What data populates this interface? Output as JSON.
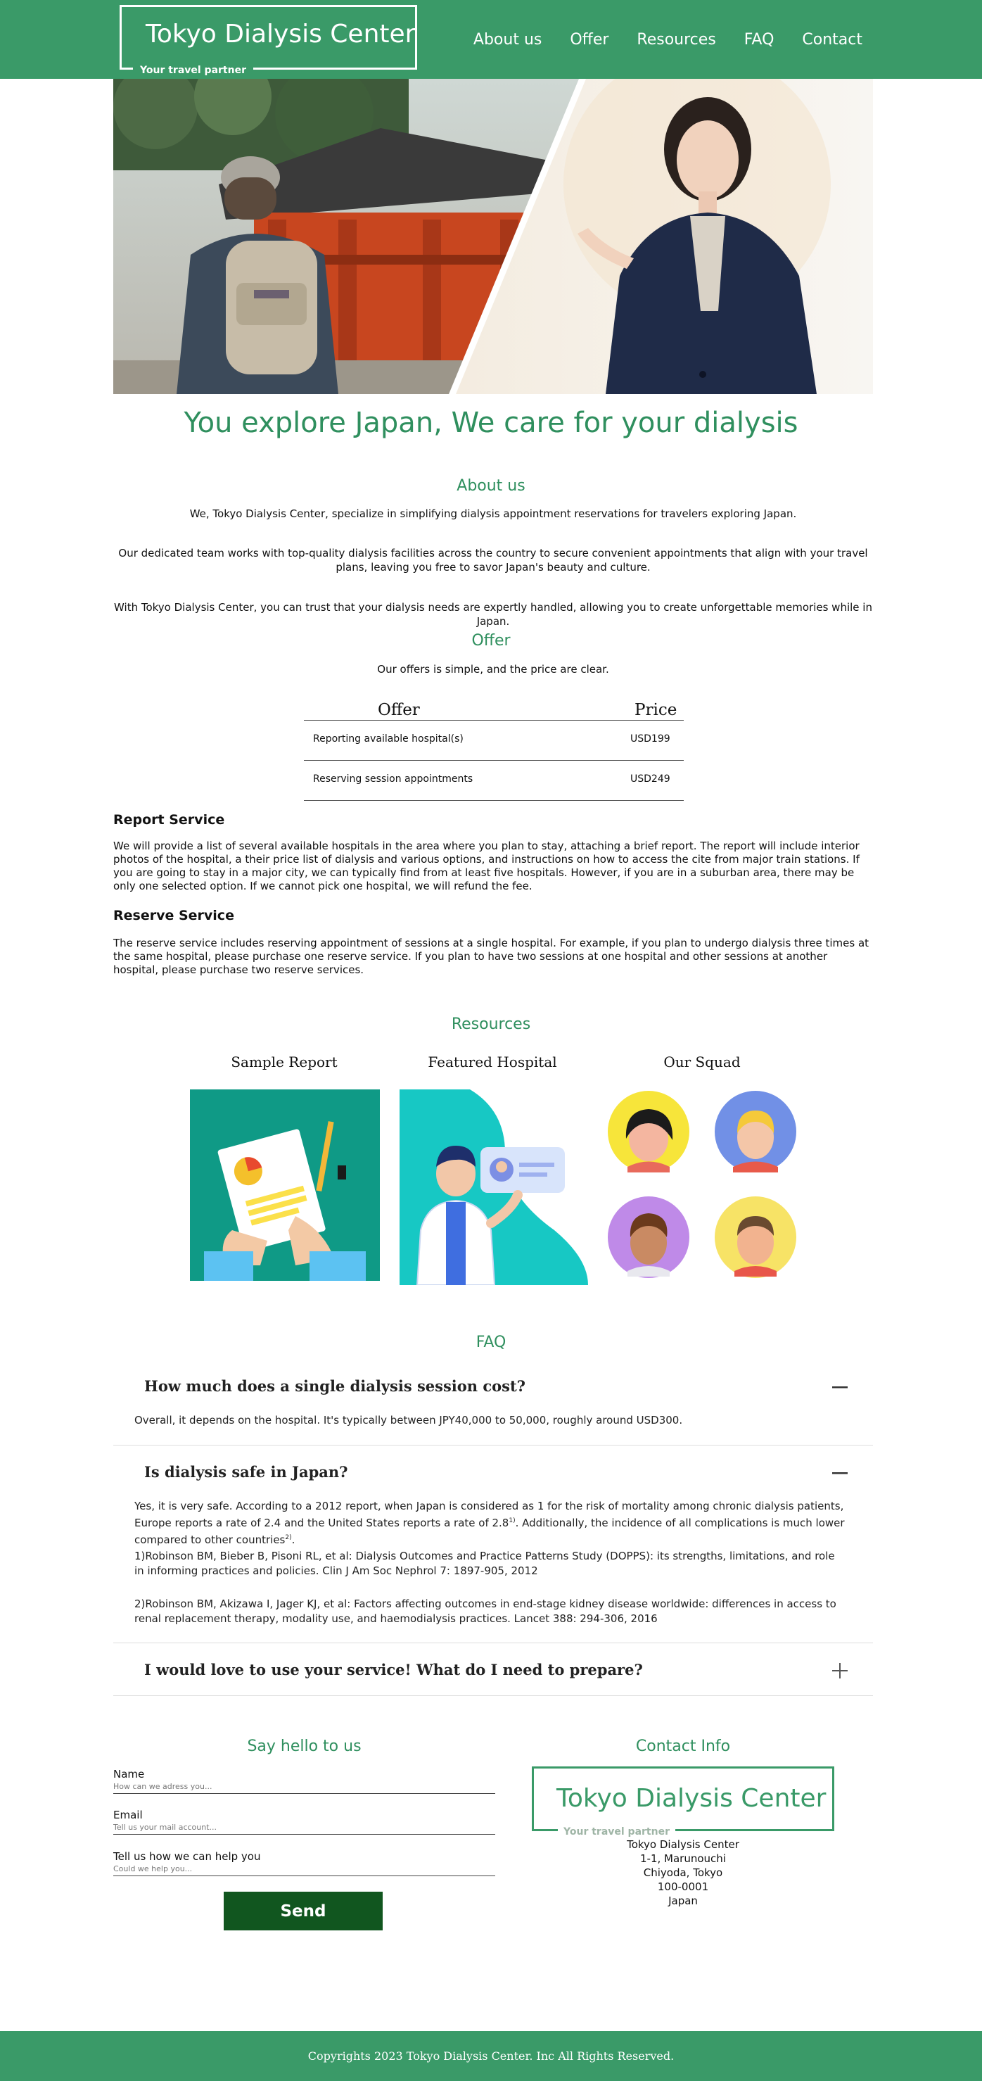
{
  "header": {
    "logo_title": "Tokyo Dialysis Center",
    "logo_tagline": "Your travel partner",
    "nav": [
      "About us",
      "Offer",
      "Resources",
      "FAQ",
      "Contact"
    ]
  },
  "tagline": "You explore Japan, We care for your dialysis",
  "about": {
    "title": "About us",
    "paragraphs": [
      "We, Tokyo Dialysis Center, specialize in simplifying dialysis appointment reservations for travelers exploring Japan.",
      "Our dedicated team works with top-quality dialysis facilities across the country to secure convenient appointments that align with your travel plans, leaving you free to savor Japan's beauty and culture.",
      "With Tokyo Dialysis Center, you can trust that your dialysis needs are expertly handled, allowing you to create unforgettable memories while in Japan."
    ]
  },
  "offer": {
    "title": "Offer",
    "intro": "Our offers is simple, and the price are clear.",
    "table": {
      "headers": [
        "Offer",
        "Price"
      ],
      "rows": [
        [
          "Reporting available hospital(s)",
          "USD199"
        ],
        [
          "Reserving session appointments",
          "USD249"
        ]
      ]
    },
    "report_service": {
      "title": "Report Service",
      "text": "We will provide a list of several available hospitals in the area where you plan to stay, attaching a brief report. The report will include interior photos of the hospital, a their price list of dialysis and various options, and instructions on how to access the cite from major train stations. If you are going to stay in a major city, we can typically find from at least five hospitals. However, if you are in a suburban area, there may be only one selected option. If we cannot pick one hospital, we will refund the fee."
    },
    "reserve_service": {
      "title": "Reserve Service",
      "text": "The reserve service includes reserving appointment of sessions at a single hospital. For example, if you plan to undergo dialysis three times at the same hospital, please purchase one reserve service. If you plan to have two sessions at one hospital and other sessions at another hospital, please purchase two reserve services."
    }
  },
  "resources": {
    "title": "Resources",
    "items": [
      "Sample Report",
      "Featured Hospital",
      "Our Squad"
    ]
  },
  "faq": {
    "title": "FAQ",
    "items": [
      {
        "question": "How much does a single dialysis session cost?",
        "answer": "Overall, it depends on the hospital. It's typically between JPY40,000 to 50,000, roughly around USD300."
      },
      {
        "question": "Is dialysis safe in Japan?",
        "answer_main": "Yes, it is very safe. According to a 2012 report, when Japan is considered as 1 for the risk of mortality among chronic dialysis patients, Europe reports a rate of 2.4 and the United States reports a rate of 2.8",
        "sup1": "1)",
        "answer_cont": ". Additionally, the incidence of all complications is much lower compared to other countries",
        "sup2": "2)",
        "answer_end": ".",
        "ref1": "1)Robinson BM, Bieber B, Pisoni RL, et al: Dialysis Outcomes and Practice Patterns Study (DOPPS): its strengths, limitations, and role in informing practices and policies. Clin J Am Soc Nephrol 7: 1897-905, 2012",
        "ref2": "2)Robinson BM, Akizawa I, Jager KJ, et al: Factors affecting outcomes in end-stage kidney disease worldwide: differences in access to renal replacement therapy, modality use, and haemodialysis practices. Lancet 388: 294-306, 2016"
      },
      {
        "question": "I would love to use your service! What do I need to prepare?"
      }
    ]
  },
  "contact_form": {
    "title": "Say hello to us",
    "name_label": "Name",
    "name_placeholder": "How can we adress you...",
    "email_label": "Email",
    "email_placeholder": "Tell us your mail account...",
    "message_label": "Tell us how we can help you",
    "message_placeholder": "Could we help you...",
    "send_label": "Send"
  },
  "contact_info": {
    "title": "Contact Info",
    "logo_title": "Tokyo Dialysis Center",
    "logo_tagline": "Your travel partner",
    "address": [
      "Tokyo Dialysis Center",
      "1-1, Marunouchi",
      "Chiyoda, Tokyo",
      "100-0001",
      "Japan"
    ]
  },
  "footer": {
    "copyright": "Copyrights 2023 Tokyo Dialysis Center. Inc All Rights Reserved."
  },
  "colors": {
    "brand_green": "#3a9a68",
    "heading_green": "#2f8f5e",
    "button_dark_green": "#11561f"
  }
}
